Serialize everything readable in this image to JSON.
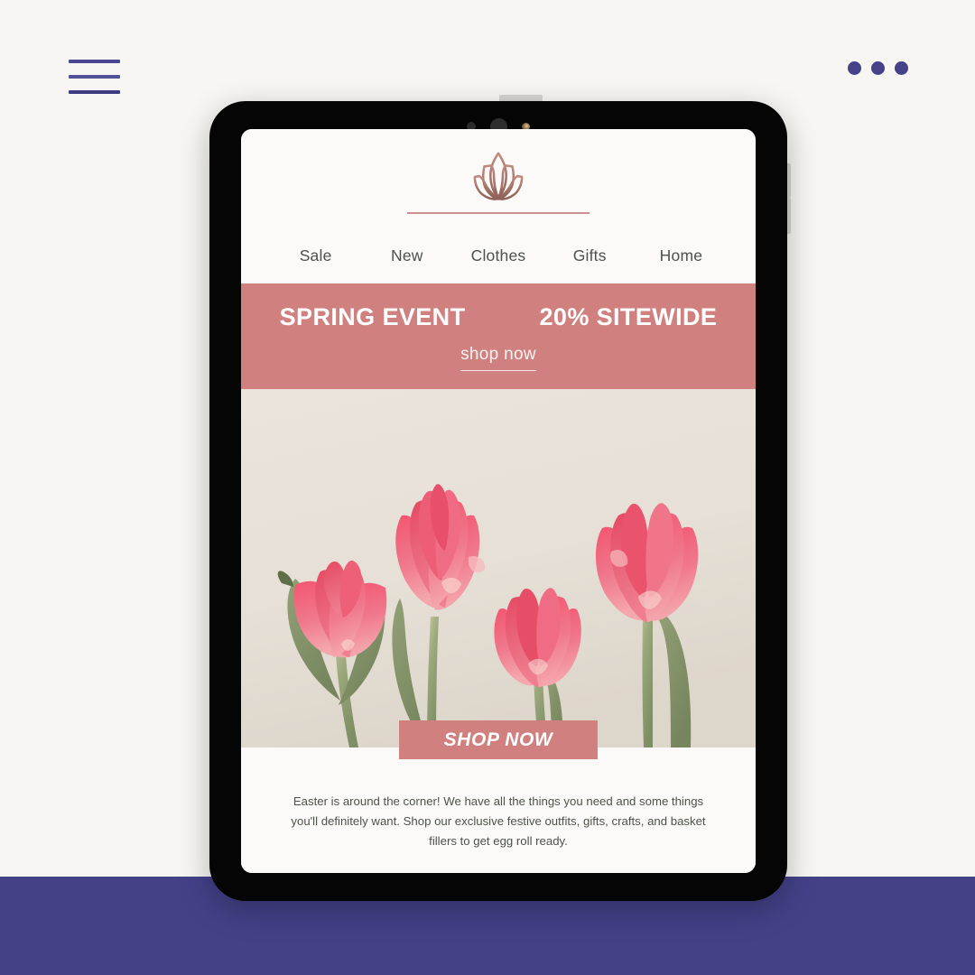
{
  "page": {
    "background_color": "#f7f6f3",
    "accent_purple": "#444189",
    "accent_rose": "#d0807f"
  },
  "topbar": {
    "menu_icon": "hamburger-menu-icon",
    "menu_bars": 3,
    "more_icon": "more-options-dots-icon",
    "more_dots": 3
  },
  "device": {
    "type": "tablet",
    "frame_color": "#050505",
    "top_button": "power-button",
    "side_buttons": [
      "volume-up-button",
      "volume-down-button"
    ],
    "camera_dots": [
      "sensor-dot",
      "front-camera",
      "indicator-light"
    ]
  },
  "screen": {
    "logo": {
      "icon": "lotus-flower-logo",
      "color": "#b07b73"
    },
    "nav": {
      "items": [
        {
          "label": "Sale"
        },
        {
          "label": "New"
        },
        {
          "label": "Clothes"
        },
        {
          "label": "Gifts"
        },
        {
          "label": "Home"
        }
      ]
    },
    "banner": {
      "headline_left": "SPRING EVENT",
      "headline_right": "20% SITEWIDE",
      "cta_label": "shop now",
      "background_color": "#d0807f"
    },
    "hero": {
      "alt": "four pink tulips on a cream wall",
      "background_color": "#e9e3da",
      "flower_color": "#f0657a",
      "stem_color": "#8e9c79"
    },
    "primary_button": {
      "label": "SHOP NOW",
      "background_color": "#d0807f",
      "text_color": "#ffffff"
    },
    "body_copy": "Easter is around the corner! We have all the things you need and some things you'll definitely want. Shop our exclusive festive outfits, gifts, crafts, and basket fillers to get egg roll ready."
  }
}
